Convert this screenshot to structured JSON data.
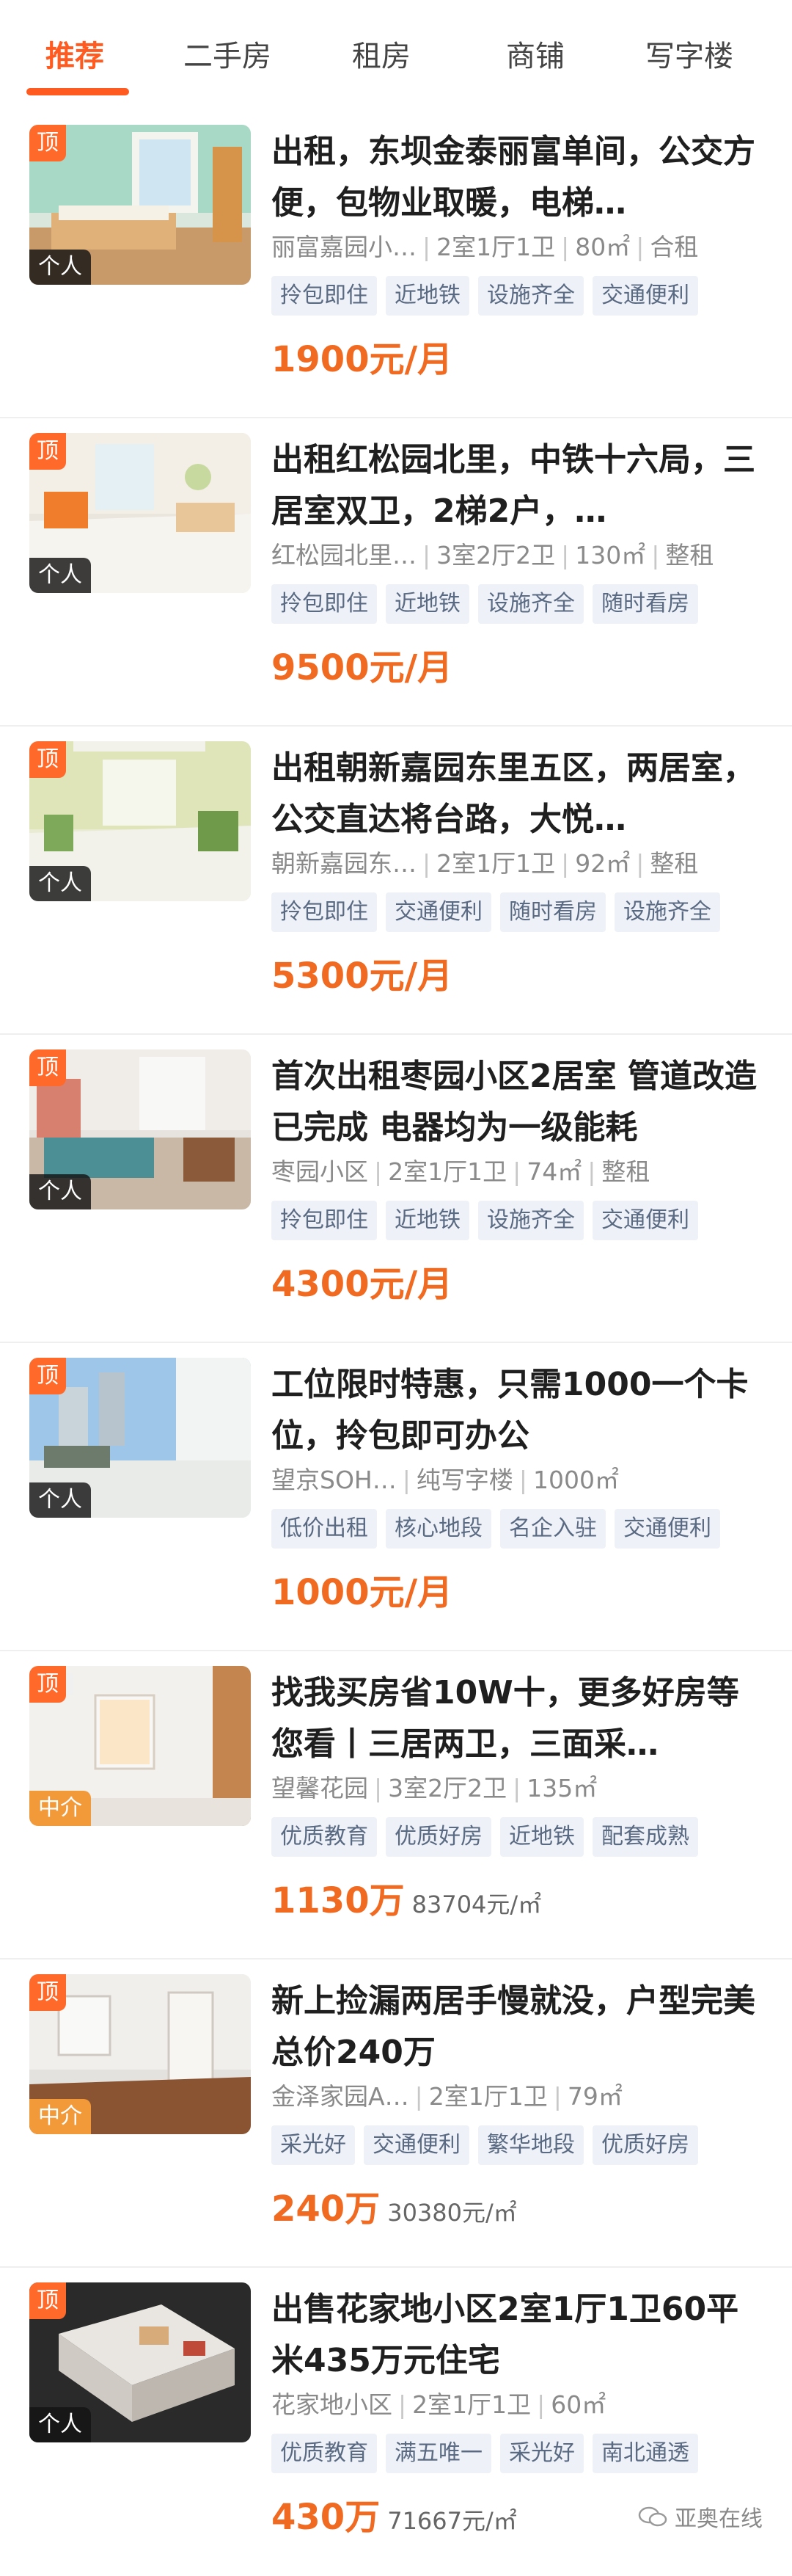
{
  "tabs": [
    {
      "label": "推荐"
    },
    {
      "label": "二手房"
    },
    {
      "label": "租房"
    },
    {
      "label": "商铺"
    },
    {
      "label": "写字楼"
    }
  ],
  "top_badge": "顶",
  "listings": [
    {
      "title": "出租，东坝金泰丽富单间，公交方便，包物业取暖，电梯…",
      "source": "个人",
      "meta": [
        "丽富嘉园小…",
        "2室1厅1卫",
        "80㎡",
        "合租"
      ],
      "tags": [
        "拎包即住",
        "近地铁",
        "设施齐全",
        "交通便利"
      ],
      "price": "1900元/月",
      "unit_price": ""
    },
    {
      "title": "出租红松园北里，中铁十六局，三居室双卫，2梯2户，…",
      "source": "个人",
      "meta": [
        "红松园北里…",
        "3室2厅2卫",
        "130㎡",
        "整租"
      ],
      "tags": [
        "拎包即住",
        "近地铁",
        "设施齐全",
        "随时看房"
      ],
      "price": "9500元/月",
      "unit_price": ""
    },
    {
      "title": "出租朝新嘉园东里五区，两居室，公交直达将台路，大悦…",
      "source": "个人",
      "meta": [
        "朝新嘉园东…",
        "2室1厅1卫",
        "92㎡",
        "整租"
      ],
      "tags": [
        "拎包即住",
        "交通便利",
        "随时看房",
        "设施齐全"
      ],
      "price": "5300元/月",
      "unit_price": ""
    },
    {
      "title": "首次出租枣园小区2居室 管道改造已完成 电器均为一级能耗",
      "source": "个人",
      "meta": [
        "枣园小区",
        "2室1厅1卫",
        "74㎡",
        "整租"
      ],
      "tags": [
        "拎包即住",
        "近地铁",
        "设施齐全",
        "交通便利"
      ],
      "price": "4300元/月",
      "unit_price": ""
    },
    {
      "title": "工位限时特惠，只需1000一个卡位，拎包即可办公",
      "source": "个人",
      "meta": [
        "望京SOH…",
        "纯写字楼",
        "1000㎡"
      ],
      "tags": [
        "低价出租",
        "核心地段",
        "名企入驻",
        "交通便利"
      ],
      "price": "1000元/月",
      "unit_price": ""
    },
    {
      "title": "找我买房省10W十，更多好房等您看丨三居两卫，三面采…",
      "source": "中介",
      "meta": [
        "望馨花园",
        "3室2厅2卫",
        "135㎡"
      ],
      "tags": [
        "优质教育",
        "优质好房",
        "近地铁",
        "配套成熟"
      ],
      "price": "1130万",
      "unit_price": "83704元/㎡"
    },
    {
      "title": "新上捡漏两居手慢就没，户型完美总价240万",
      "source": "中介",
      "meta": [
        "金泽家园A…",
        "2室1厅1卫",
        "79㎡"
      ],
      "tags": [
        "采光好",
        "交通便利",
        "繁华地段",
        "优质好房"
      ],
      "price": "240万",
      "unit_price": "30380元/㎡"
    },
    {
      "title": "出售花家地小区2室1厅1卫60平米435万元住宅",
      "source": "个人",
      "meta": [
        "花家地小区",
        "2室1厅1卫",
        "60㎡"
      ],
      "tags": [
        "优质教育",
        "满五唯一",
        "采光好",
        "南北通透"
      ],
      "price": "430万",
      "unit_price": "71667元/㎡"
    }
  ],
  "watermark": "亚奥在线",
  "colors": {
    "accent": "#ff5a1f",
    "price": "#f06a22",
    "tag_bg": "#eef2f8",
    "tag_text": "#5a6a82",
    "agency_badge": "#f29a3a"
  }
}
